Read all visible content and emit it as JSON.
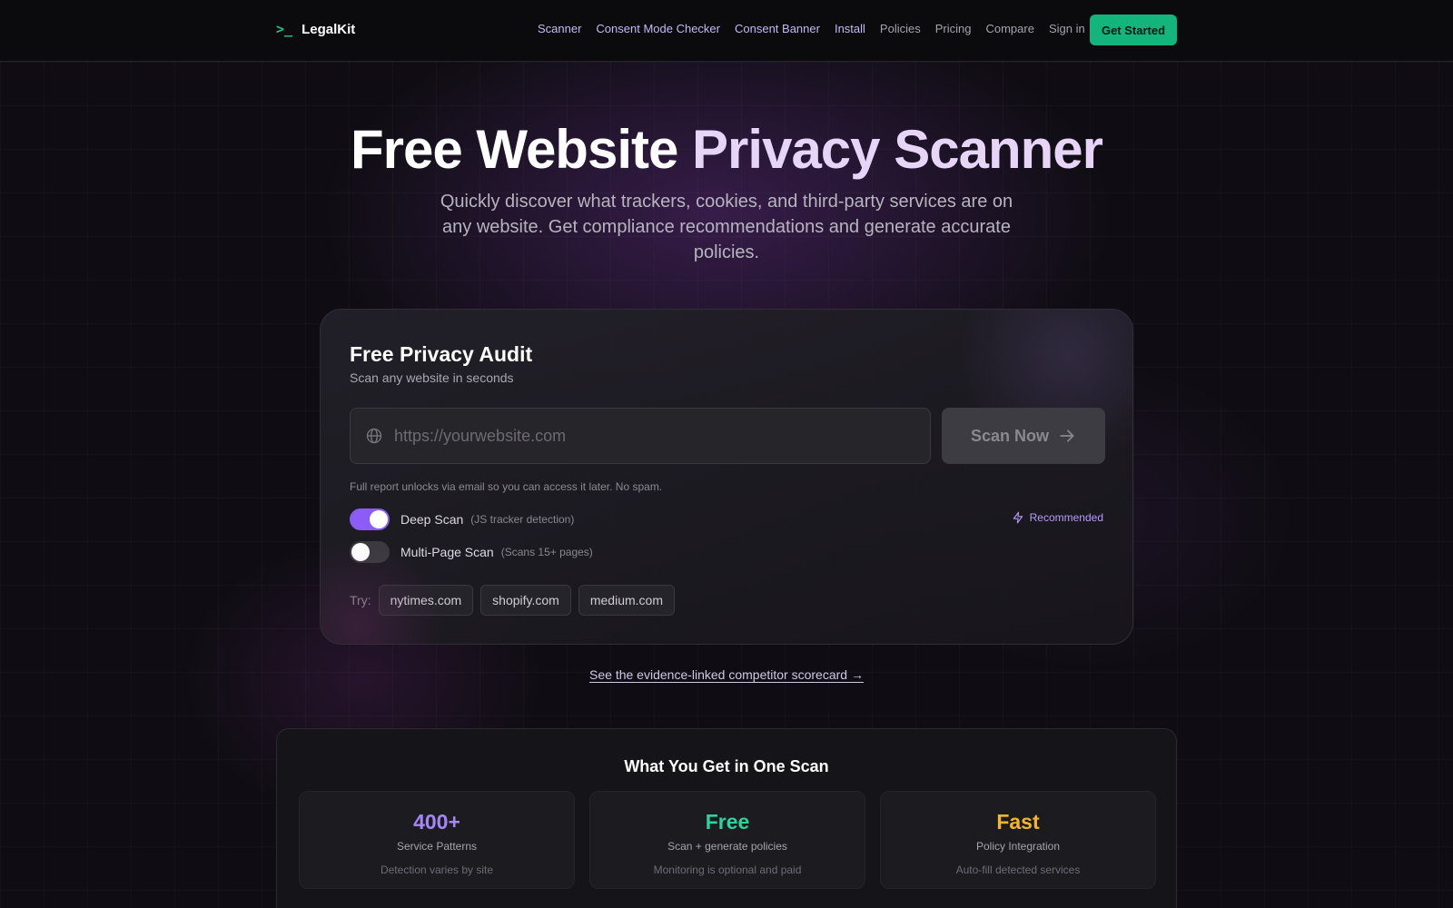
{
  "brand": {
    "mark": ">_",
    "name": "LegalKit"
  },
  "nav": {
    "items": [
      {
        "label": "Scanner",
        "style": "hl"
      },
      {
        "label": "Consent Mode Checker",
        "style": "hl"
      },
      {
        "label": "Consent Banner",
        "style": "hl"
      },
      {
        "label": "Install",
        "style": "hl"
      },
      {
        "label": "Policies",
        "style": "mut"
      },
      {
        "label": "Pricing",
        "style": "mut"
      },
      {
        "label": "Compare",
        "style": "mut"
      },
      {
        "label": "Sign in",
        "style": "mut"
      }
    ],
    "cta": "Get Started"
  },
  "hero": {
    "title_part1": "Free Website ",
    "title_part2": "Privacy Scanner",
    "subtitle": "Quickly discover what trackers, cookies, and third-party services are on any website. Get compliance recommendations and generate accurate policies."
  },
  "audit": {
    "title": "Free Privacy Audit",
    "subtitle": "Scan any website in seconds",
    "url_placeholder": "https://yourwebsite.com",
    "url_value": "",
    "scan_button": "Scan Now",
    "note": "Full report unlocks via email so you can access it later. No spam.",
    "deep_scan": {
      "label": "Deep Scan",
      "hint": "(JS tracker detection)",
      "enabled": true
    },
    "multi_page": {
      "label": "Multi-Page Scan",
      "hint": "(Scans 15+ pages)",
      "enabled": false
    },
    "recommended": "Recommended",
    "try_label": "Try:",
    "examples": [
      "nytimes.com",
      "shopify.com",
      "medium.com"
    ]
  },
  "scorecard_link": "See the evidence-linked competitor scorecard →",
  "features": {
    "title": "What You Get in One Scan",
    "items": [
      {
        "value": "400+",
        "label": "Service Patterns",
        "desc": "Detection varies by site",
        "color": "#a685f7"
      },
      {
        "value": "Free",
        "label": "Scan + generate policies",
        "desc": "Monitoring is optional and paid",
        "color": "#2fd39a"
      },
      {
        "value": "Fast",
        "label": "Policy Integration",
        "desc": "Auto-fill detected services",
        "color": "#f5b42e"
      }
    ]
  },
  "colors": {
    "accent_green": "#14b57c",
    "accent_purple": "#8b5cf6",
    "background": "#0f0d13"
  }
}
